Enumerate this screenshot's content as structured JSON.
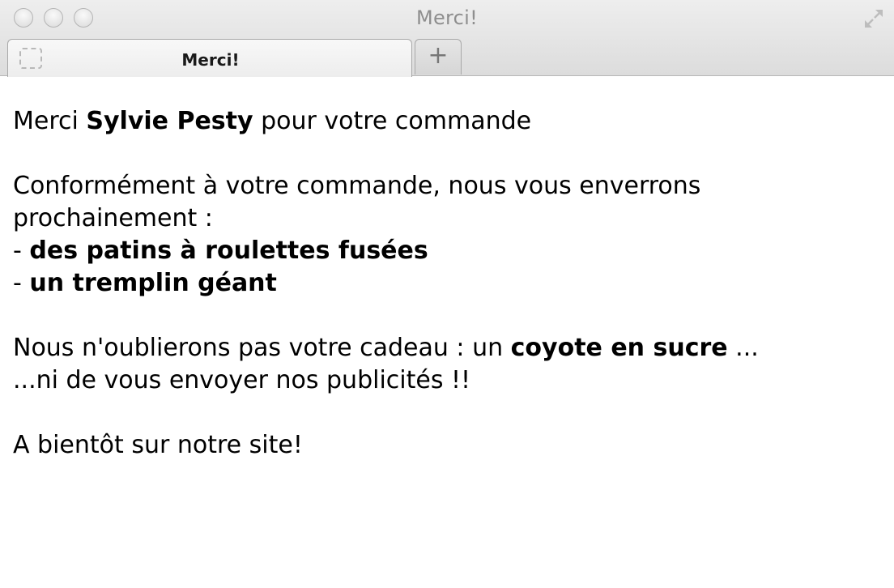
{
  "window": {
    "title": "Merci!"
  },
  "tabs": [
    {
      "label": "Merci!"
    }
  ],
  "new_tab": {
    "label": "+"
  },
  "icons": {
    "favicon": "placeholder-favicon-icon",
    "fullscreen": "fullscreen-arrows-icon",
    "new_tab": "plus-icon"
  },
  "content": {
    "greeting": {
      "before": "Merci ",
      "name": "Sylvie Pesty",
      "after": " pour votre commande"
    },
    "intro": "Conformément à votre commande, nous vous enverrons prochainement :",
    "items": [
      {
        "prefix": "- ",
        "label": "des patins à roulettes fusées"
      },
      {
        "prefix": "- ",
        "label": "un tremplin géant"
      }
    ],
    "gift": {
      "before": "Nous n'oublierons pas votre cadeau : un ",
      "item": "coyote en sucre",
      "after": " ..."
    },
    "ads": "...ni de vous envoyer nos publicités !!",
    "closing": "A bientôt sur notre site!"
  }
}
